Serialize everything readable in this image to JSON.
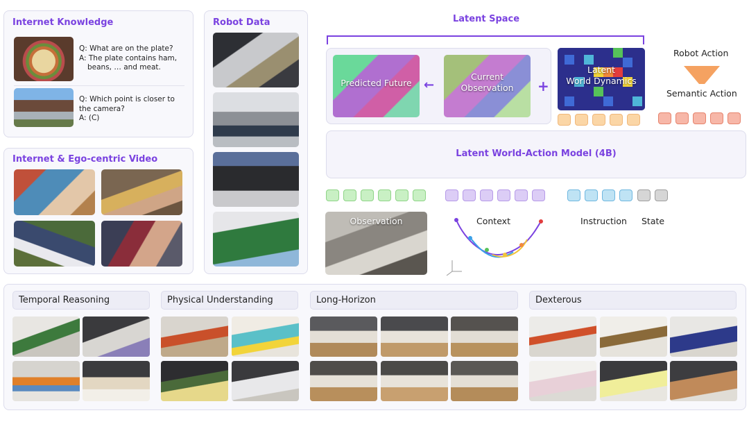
{
  "internet_knowledge": {
    "title": "Internet Knowledge",
    "qa1": {
      "q": "Q: What are on the plate?",
      "a1": "A: The plate contains ham,",
      "a2": "beans, … and meat."
    },
    "qa2": {
      "q1": "Q: Which point is closer to",
      "q2": "the camera?",
      "a": "A: (C)"
    }
  },
  "ego_video": {
    "title": "Internet & Ego-centric Video"
  },
  "robot_data": {
    "title": "Robot Data"
  },
  "latent_space": {
    "title": "Latent Space",
    "predicted_future": "Predicted Future",
    "current_observation_1": "Current",
    "current_observation_2": "Observation",
    "plus": "+",
    "latent_dynamics_1": "Latent",
    "latent_dynamics_2": "World Dynamics",
    "arrow": "←"
  },
  "action": {
    "robot_action": "Robot Action",
    "semantic_action": "Semantic Action"
  },
  "model": {
    "label": "Latent World-Action Model (4B)"
  },
  "inputs": {
    "observation": "Observation",
    "context": "Context",
    "instruction": "Instruction",
    "state": "State"
  },
  "categories": [
    {
      "label": "Temporal Reasoning"
    },
    {
      "label": "Physical Understanding"
    },
    {
      "label": "Long-Horizon"
    },
    {
      "label": "Dexterous"
    }
  ],
  "colors": {
    "accent_purple": "#7a42e0",
    "token_orange": "#fbd6a6",
    "token_red": "#f7b7a8",
    "token_green": "#c9f0c4",
    "token_purple": "#dccdf6",
    "token_blue": "#bfe3f4",
    "token_gray": "#d6d6d6"
  }
}
